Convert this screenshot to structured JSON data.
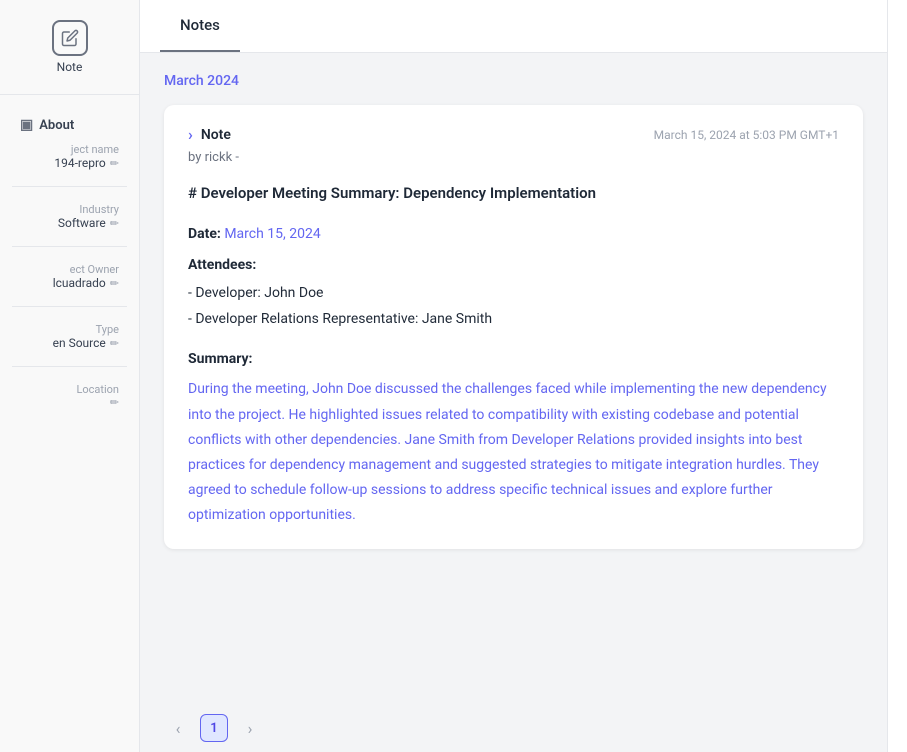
{
  "sidebar": {
    "note_label": "Note",
    "about_label": "About",
    "about_icon": "□",
    "fields": {
      "project_name_label": "ject name",
      "project_name_value": "194-repro",
      "industry_label": "Industry",
      "software_label": "Software",
      "owner_label": "ect Owner",
      "owner_value": "lcuadrado",
      "type_label": "Type",
      "type_value": "en Source",
      "location_label": "Location"
    }
  },
  "tabs": {
    "notes": "Notes"
  },
  "content": {
    "month_header": "March 2024",
    "note": {
      "type_label": "Note",
      "timestamp": "March 15, 2024 at 5:03 PM GMT+1",
      "author": "by rickk -",
      "title": "# Developer Meeting Summary: Dependency Implementation",
      "date_label": "**Date:**",
      "date_value": "March 15, 2024",
      "attendees_label": "**Attendees:**",
      "attendee1": "- Developer: John Doe",
      "attendee2": "- Developer Relations Representative: Jane Smith",
      "summary_label": "**Summary:**",
      "summary_text": "During the meeting, John Doe discussed the challenges faced while implementing the new dependency into the project. He highlighted issues related to compatibility with existing codebase and potential conflicts with other dependencies. Jane Smith from Developer Relations provided insights into best practices for dependency management and suggested strategies to mitigate integration hurdles. They agreed to schedule follow-up sessions to address specific technical issues and explore further optimization opportunities."
    }
  },
  "pagination": {
    "prev_label": "‹",
    "current": "1",
    "next_label": "›"
  }
}
